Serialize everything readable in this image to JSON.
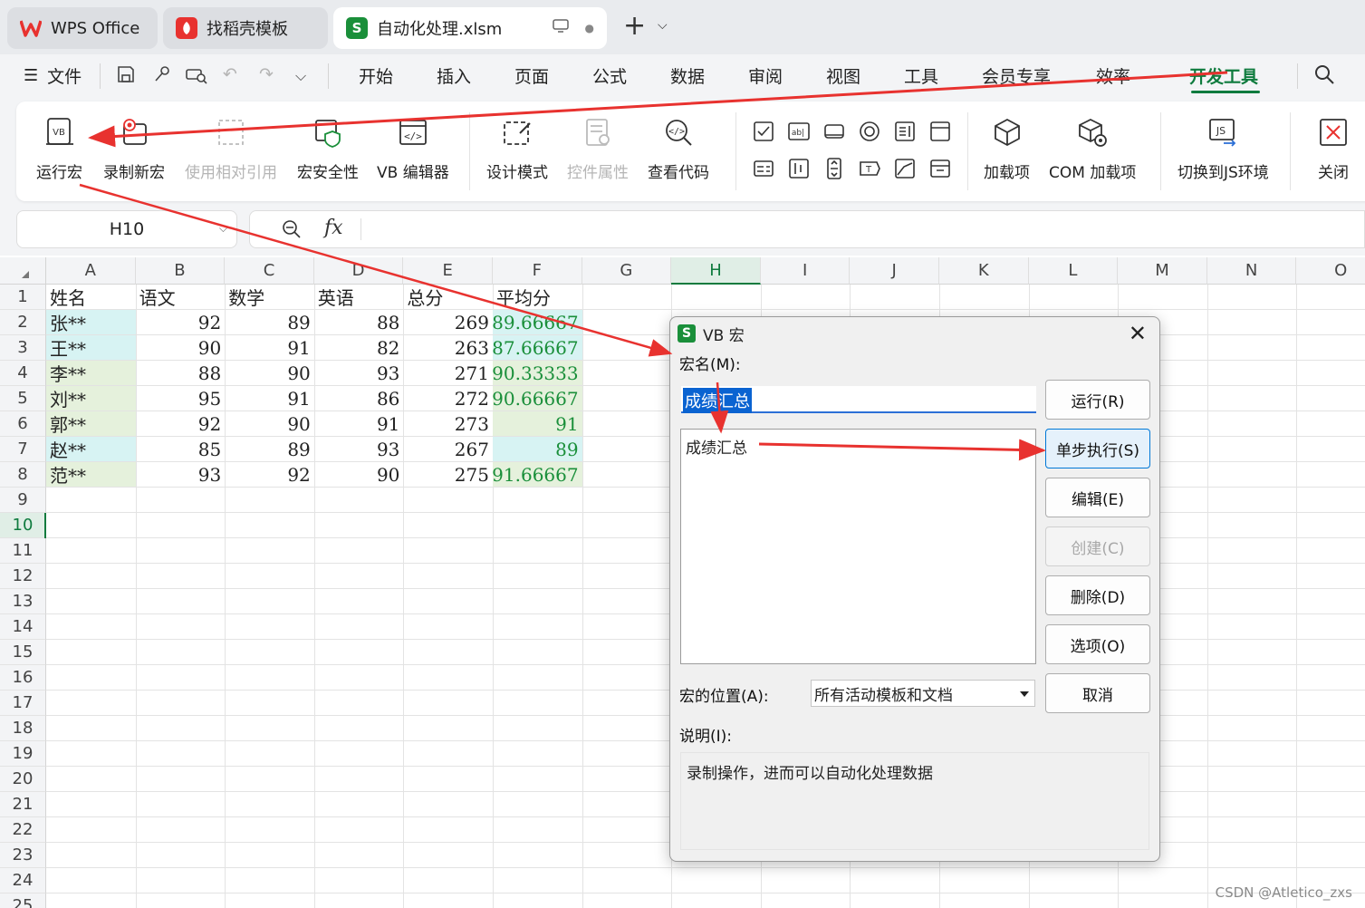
{
  "tabs": [
    {
      "label": "WPS Office",
      "icon": "wps-logo-icon"
    },
    {
      "label": "找稻壳模板",
      "icon": "docer-icon"
    },
    {
      "label": "自动化处理.xlsm",
      "icon": "spreadsheet-icon"
    }
  ],
  "menu": {
    "file": "文件",
    "items": [
      "开始",
      "插入",
      "页面",
      "公式",
      "数据",
      "审阅",
      "视图",
      "工具",
      "会员专享",
      "效率",
      "开发工具"
    ]
  },
  "ribbon": {
    "buttons": [
      "运行宏",
      "录制新宏",
      "使用相对引用",
      "宏安全性",
      "VB 编辑器",
      "设计模式",
      "控件属性",
      "查看代码",
      "加载项",
      "COM 加载项",
      "切换到JS环境",
      "关闭"
    ]
  },
  "namebox": "H10",
  "columns": [
    "A",
    "B",
    "C",
    "D",
    "E",
    "F",
    "G",
    "H",
    "I",
    "J",
    "K",
    "L",
    "M",
    "N",
    "O"
  ],
  "rows": [
    "1",
    "2",
    "3",
    "4",
    "5",
    "6",
    "7",
    "8",
    "9",
    "10",
    "11",
    "12",
    "13",
    "14",
    "15",
    "16",
    "17",
    "18",
    "19",
    "20",
    "21",
    "22",
    "23",
    "24",
    "25"
  ],
  "sheet": {
    "headers": [
      "姓名",
      "语文",
      "数学",
      "英语",
      "总分",
      "平均分"
    ],
    "data": [
      [
        "张**",
        "92",
        "89",
        "88",
        "269",
        "89.66667"
      ],
      [
        "王**",
        "90",
        "91",
        "82",
        "263",
        "87.66667"
      ],
      [
        "李**",
        "88",
        "90",
        "93",
        "271",
        "90.33333"
      ],
      [
        "刘**",
        "95",
        "91",
        "86",
        "272",
        "90.66667"
      ],
      [
        "郭**",
        "92",
        "90",
        "91",
        "273",
        "91"
      ],
      [
        "赵**",
        "85",
        "89",
        "93",
        "267",
        "89"
      ],
      [
        "范**",
        "93",
        "92",
        "90",
        "275",
        "91.66667"
      ]
    ],
    "row_fill": [
      "#d7f3f3",
      "#d7f3f3",
      "#e5f1dc",
      "#e5f1dc",
      "#e5f1dc",
      "#d7f3f3",
      "#e5f1dc"
    ]
  },
  "dialog": {
    "title": "VB 宏",
    "macro_name_label": "宏名(M):",
    "macro_name_value": "成绩汇总",
    "list_items": [
      "成绩汇总"
    ],
    "buttons": [
      "运行(R)",
      "单步执行(S)",
      "编辑(E)",
      "创建(C)",
      "删除(D)",
      "选项(O)",
      "取消"
    ],
    "location_label": "宏的位置(A):",
    "location_value": "所有活动模板和文档",
    "description_label": "说明(I):",
    "description_value": "录制操作，进而可以自动化处理数据"
  },
  "watermark": "CSDN @Atletico_zxs",
  "colors": {
    "accent": "#0f7b3e",
    "arrow": "#e8322f",
    "selection": "#0a63d1"
  }
}
